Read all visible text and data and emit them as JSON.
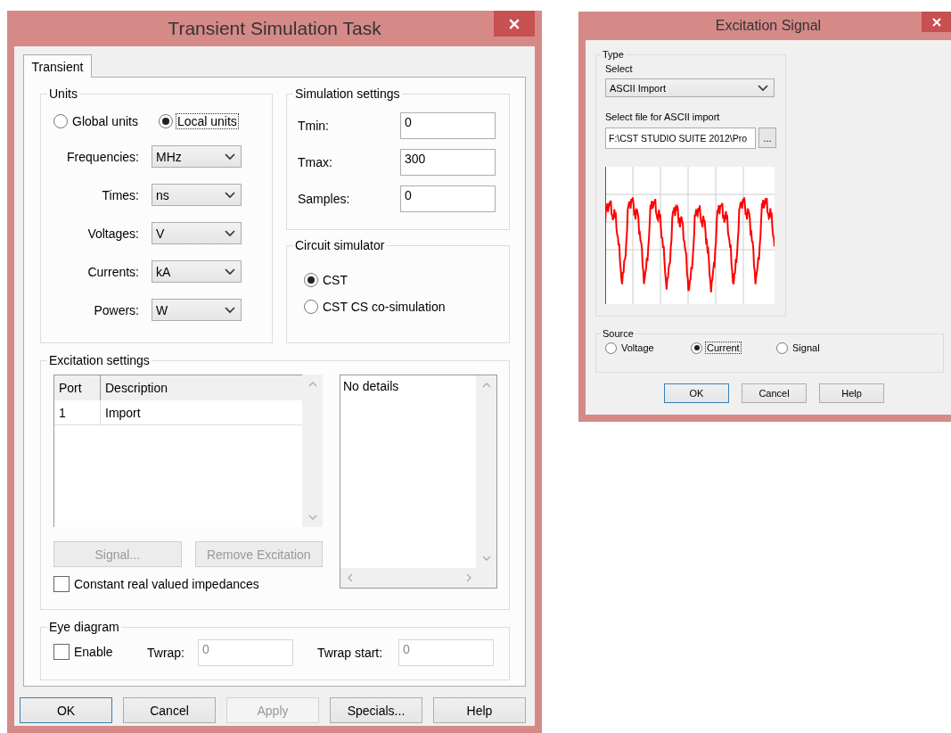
{
  "main_dialog": {
    "title": "Transient Simulation Task",
    "tabs": [
      {
        "label": "Transient",
        "selected": true
      }
    ],
    "units": {
      "title": "Units",
      "modes": [
        {
          "label": "Global units",
          "selected": false,
          "focused": false
        },
        {
          "label": "Local units",
          "selected": true,
          "focused": true
        }
      ],
      "rows": [
        {
          "label": "Frequencies:",
          "value": "MHz"
        },
        {
          "label": "Times:",
          "value": "ns"
        },
        {
          "label": "Voltages:",
          "value": "V"
        },
        {
          "label": "Currents:",
          "value": "kA"
        },
        {
          "label": "Powers:",
          "value": "W"
        }
      ]
    },
    "simulation_settings": {
      "title": "Simulation settings",
      "fields": [
        {
          "label": "Tmin:",
          "value": "0"
        },
        {
          "label": "Tmax:",
          "value": "300"
        },
        {
          "label": "Samples:",
          "value": "0"
        }
      ]
    },
    "circuit_simulator": {
      "title": "Circuit simulator",
      "options": [
        {
          "label": "CST",
          "selected": true
        },
        {
          "label": "CST CS co-simulation",
          "selected": false
        }
      ]
    },
    "excitation_settings": {
      "title": "Excitation settings",
      "table": {
        "columns": [
          "Port",
          "Description"
        ],
        "rows": [
          [
            "1",
            "Import"
          ]
        ]
      },
      "details": "No details",
      "buttons": [
        {
          "label": "Signal...",
          "disabled": true
        },
        {
          "label": "Remove Excitation",
          "disabled": true
        }
      ],
      "checkbox": {
        "label": "Constant real valued impedances",
        "checked": false
      }
    },
    "eye_diagram": {
      "title": "Eye diagram",
      "enable": {
        "label": "Enable",
        "checked": false
      },
      "fields": [
        {
          "label": "Twrap:",
          "value": "0",
          "disabled": true
        },
        {
          "label": "Twrap start:",
          "value": "0",
          "disabled": true
        }
      ]
    },
    "buttons": [
      {
        "label": "OK",
        "default": true,
        "disabled": false
      },
      {
        "label": "Cancel",
        "default": false,
        "disabled": false
      },
      {
        "label": "Apply",
        "default": false,
        "disabled": true
      },
      {
        "label": "Specials...",
        "default": false,
        "disabled": false
      },
      {
        "label": "Help",
        "default": false,
        "disabled": false
      }
    ]
  },
  "signal_dialog": {
    "title": "Excitation Signal",
    "type_group": {
      "title": "Type",
      "select_label": "Select",
      "select_value": "ASCII Import",
      "file_label": "Select file for ASCII import",
      "file_value": "F:\\CST STUDIO SUITE 2012\\Pro",
      "browse": "..."
    },
    "source": {
      "title": "Source",
      "options": [
        {
          "label": "Voltage",
          "selected": false,
          "focused": false
        },
        {
          "label": "Current",
          "selected": true,
          "focused": true
        },
        {
          "label": "Signal",
          "selected": false,
          "focused": false
        }
      ]
    },
    "buttons": [
      {
        "label": "OK",
        "default": true,
        "disabled": false
      },
      {
        "label": "Cancel",
        "default": false,
        "disabled": false
      },
      {
        "label": "Help",
        "default": false,
        "disabled": false
      }
    ]
  }
}
